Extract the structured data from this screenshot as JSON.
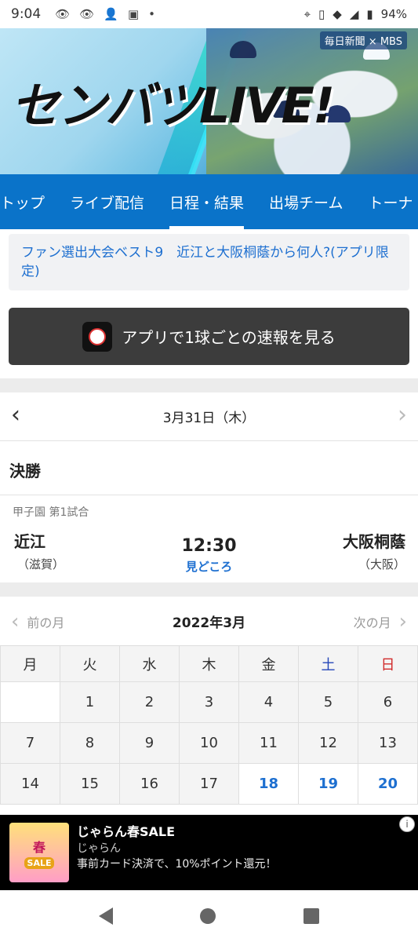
{
  "status": {
    "time": "9:04",
    "battery": "94%",
    "icons": [
      "eye-icon",
      "eye-icon",
      "person-add-icon",
      "d-icon",
      "dot-icon",
      "location-icon",
      "vibrate-icon",
      "wifi-icon",
      "signal-icon",
      "battery-icon"
    ]
  },
  "hero": {
    "title": "センバツLIVE!",
    "sponsor": "毎日新聞 × MBS"
  },
  "tabs": [
    "トップ",
    "ライブ配信",
    "日程・結果",
    "出場チーム",
    "トーナ"
  ],
  "active_tab": "日程・結果",
  "news": {
    "text": "ファン選出大会ベスト9　近江と大阪桐蔭から何人?(アプリ限定)"
  },
  "app_button": {
    "icon_label": "SportsNavi",
    "label": "アプリで1球ごとの速報を見る"
  },
  "date_nav": {
    "date": "3月31日（木）"
  },
  "game": {
    "round": "決勝",
    "venue": "甲子園 第1試合",
    "team_left": "近江",
    "pref_left": "（滋賀）",
    "team_right": "大阪桐蔭",
    "pref_right": "（大阪）",
    "time": "12:30",
    "preview_link": "見どころ"
  },
  "calendar": {
    "prev_label": "前の月",
    "next_label": "次の月",
    "month": "2022年3月",
    "weekdays": [
      "月",
      "火",
      "水",
      "木",
      "金",
      "土",
      "日"
    ],
    "rows": [
      [
        "",
        "1",
        "2",
        "3",
        "4",
        "5",
        "6"
      ],
      [
        "7",
        "8",
        "9",
        "10",
        "11",
        "12",
        "13"
      ],
      [
        "14",
        "15",
        "16",
        "17",
        "18",
        "19",
        "20"
      ]
    ],
    "highlighted_days": [
      "18",
      "19",
      "20"
    ],
    "colors": {
      "sat": "#2446b8",
      "sun": "#d12b2b",
      "highlight": "#1d6fd0"
    }
  },
  "ad": {
    "thumb_text": "春",
    "thumb_sub": "SALE",
    "title": "じゃらん春SALE",
    "advertiser": "じゃらん",
    "description": "事前カード決済で、10%ポイント還元！"
  },
  "colors": {
    "tab_bg": "#0a73c9",
    "link": "#1d6fd0",
    "button_bg": "#3c3c3c"
  }
}
